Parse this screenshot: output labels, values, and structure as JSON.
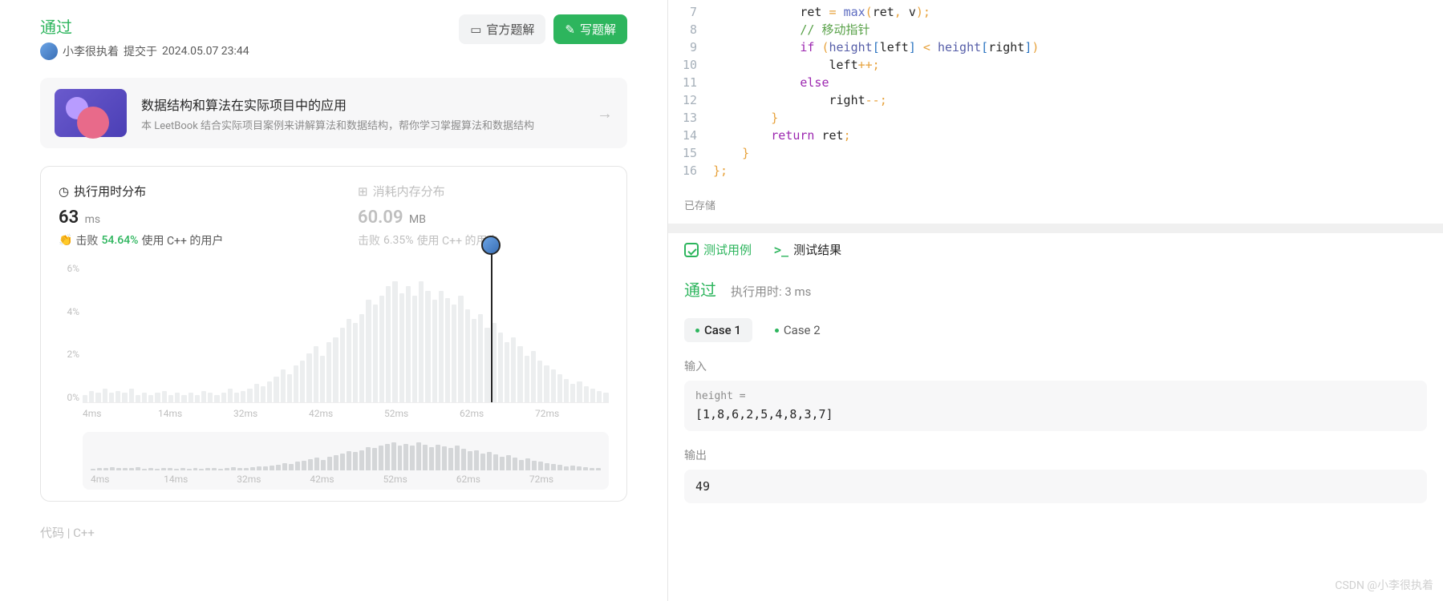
{
  "left": {
    "status": "通过",
    "username": "小李很执着",
    "submitLabel": "提交于",
    "submitTime": "2024.05.07 23:44",
    "btnOfficial": "官方题解",
    "btnWrite": "写题解",
    "promo": {
      "title": "数据结构和算法在实际项目中的应用",
      "desc": "本 LeetBook 结合实际项目案例来讲解算法和数据结构，帮你学习掌握算法和数据结构"
    },
    "runtime": {
      "label": "执行用时分布",
      "value": "63",
      "unit": "ms",
      "beatPrefix": "击败",
      "beatPct": "54.64%",
      "beatSuffix": "使用 C++ 的用户"
    },
    "memory": {
      "label": "消耗内存分布",
      "value": "60.09",
      "unit": "MB",
      "beatPrefix": "击败",
      "beatPct": "6.35%",
      "beatSuffix": "使用 C++ 的用户"
    },
    "codeLabel": "代码 | C++"
  },
  "right": {
    "savedLabel": "已存储",
    "tabTestcase": "测试用例",
    "tabResult": "测试结果",
    "resPass": "通过",
    "resTimeLabel": "执行用时: 3 ms",
    "case1": "Case 1",
    "case2": "Case 2",
    "inputLabel": "输入",
    "heightKey": "height =",
    "heightVal": "[1,8,6,2,5,4,8,3,7]",
    "outputLabel": "输出",
    "outputVal": "49"
  },
  "watermark": "CSDN @小李很执着",
  "chart_data": {
    "type": "bar",
    "title": "执行用时分布",
    "xlabel": "ms",
    "ylabel": "%",
    "ylim": [
      0,
      6
    ],
    "ytick": [
      "6%",
      "4%",
      "2%",
      "0%"
    ],
    "xtick": [
      "4ms",
      "14ms",
      "32ms",
      "42ms",
      "52ms",
      "62ms",
      "72ms"
    ],
    "marker_x": 63,
    "values": [
      0.3,
      0.5,
      0.4,
      0.6,
      0.4,
      0.5,
      0.4,
      0.6,
      0.3,
      0.4,
      0.3,
      0.4,
      0.5,
      0.3,
      0.4,
      0.3,
      0.4,
      0.3,
      0.5,
      0.4,
      0.3,
      0.4,
      0.6,
      0.4,
      0.5,
      0.6,
      0.8,
      0.7,
      0.9,
      1.1,
      1.4,
      1.2,
      1.6,
      1.8,
      2.1,
      2.4,
      2.0,
      2.6,
      2.8,
      3.2,
      3.6,
      3.4,
      3.8,
      4.4,
      4.2,
      4.6,
      5.0,
      5.2,
      4.7,
      5.0,
      4.6,
      5.2,
      4.8,
      4.4,
      4.8,
      4.5,
      4.2,
      4.6,
      4.0,
      3.6,
      3.8,
      3.2,
      3.4,
      3.0,
      2.6,
      2.8,
      2.4,
      2.0,
      2.2,
      1.8,
      1.6,
      1.4,
      1.2,
      1.0,
      0.8,
      0.9,
      0.7,
      0.6,
      0.5,
      0.4
    ]
  },
  "code": {
    "lines": [
      {
        "n": 7,
        "html": "            ret <span class='c-br'>=</span> <span class='c-fn'>max</span><span class='c-br'>(</span>ret<span class='c-br'>,</span> v<span class='c-br'>)</span><span class='c-br'>;</span>"
      },
      {
        "n": 8,
        "html": "            <span class='c-com'>// 移动指针</span>"
      },
      {
        "n": 9,
        "html": "            <span class='c-pu'>if</span> <span class='c-br'>(</span><span class='c-var'>height</span><span class='c-bl'>[</span>left<span class='c-bl'>]</span> <span class='c-br'>&lt;</span> <span class='c-var'>height</span><span class='c-bl'>[</span>right<span class='c-bl'>]</span><span class='c-br'>)</span>"
      },
      {
        "n": 10,
        "html": "                left<span class='c-br'>++;</span>"
      },
      {
        "n": 11,
        "html": "            <span class='c-pu'>else</span>"
      },
      {
        "n": 12,
        "html": "                right<span class='c-br'>--;</span>"
      },
      {
        "n": 13,
        "html": "        <span class='c-br'>}</span>"
      },
      {
        "n": 14,
        "html": "        <span class='c-pu'>return</span> ret<span class='c-br'>;</span>"
      },
      {
        "n": 15,
        "html": "    <span class='c-br'>}</span>"
      },
      {
        "n": 16,
        "html": "<span class='c-br'>};</span>"
      }
    ]
  }
}
